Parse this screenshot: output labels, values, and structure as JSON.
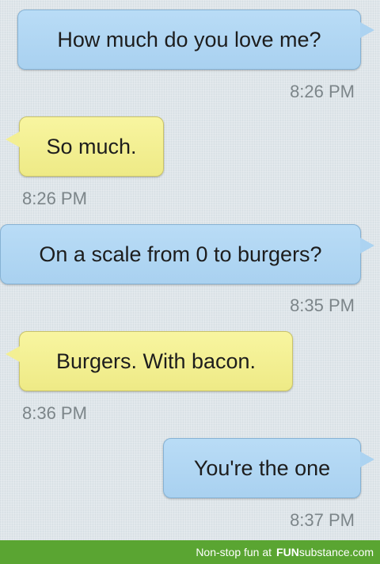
{
  "messages": [
    {
      "direction": "sent",
      "text": "How much do you love me?",
      "time": "8:26 PM"
    },
    {
      "direction": "received",
      "text": "So much.",
      "time": "8:26 PM"
    },
    {
      "direction": "sent",
      "text": "On a scale from 0 to burgers?",
      "time": "8:35 PM"
    },
    {
      "direction": "received",
      "text": "Burgers. With bacon.",
      "time": "8:36 PM"
    },
    {
      "direction": "sent",
      "text": "You're the one",
      "time": "8:37 PM"
    }
  ],
  "footer": {
    "tagline": "Non-stop fun at",
    "brand_bold": "FUN",
    "brand_rest": "substance.com"
  },
  "colors": {
    "sent_bubble": "#acd3f1",
    "received_bubble": "#f3ef93",
    "background": "#dfe6ea",
    "footer": "#5aa532"
  }
}
